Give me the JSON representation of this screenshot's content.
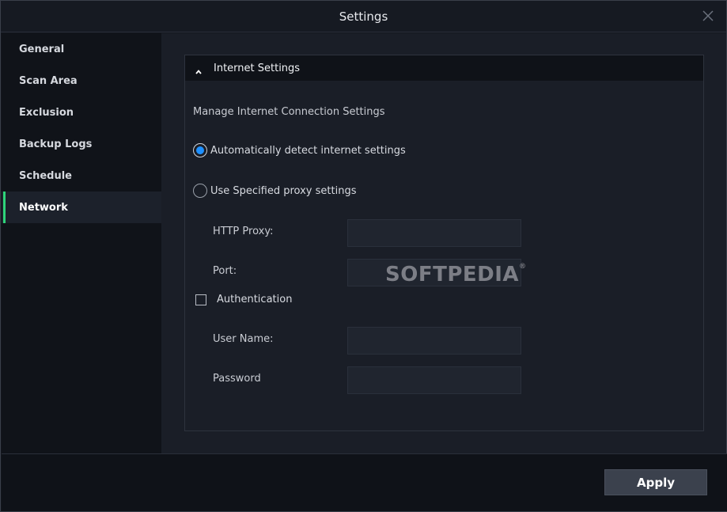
{
  "window": {
    "title": "Settings"
  },
  "sidebar": {
    "items": [
      {
        "label": "General",
        "active": false
      },
      {
        "label": "Scan Area",
        "active": false
      },
      {
        "label": "Exclusion",
        "active": false
      },
      {
        "label": "Backup Logs",
        "active": false
      },
      {
        "label": "Schedule",
        "active": false
      },
      {
        "label": "Network",
        "active": true
      }
    ]
  },
  "panel": {
    "header": "Internet Settings",
    "description": "Manage Internet Connection Settings",
    "radio_auto": {
      "label": "Automatically detect internet settings",
      "checked": true
    },
    "radio_proxy": {
      "label": "Use Specified proxy settings",
      "checked": false
    },
    "http_proxy": {
      "label": "HTTP Proxy:",
      "value": ""
    },
    "port": {
      "label": "Port:",
      "value": ""
    },
    "authentication": {
      "label": "Authentication",
      "checked": false
    },
    "username": {
      "label": "User Name:",
      "value": ""
    },
    "password": {
      "label": "Password",
      "value": ""
    }
  },
  "watermark": "SOFTPEDIA",
  "footer": {
    "apply_label": "Apply"
  },
  "colors": {
    "accent": "#2fd47a",
    "radio_selected": "#1e90ff",
    "background": "#1a1e27"
  }
}
